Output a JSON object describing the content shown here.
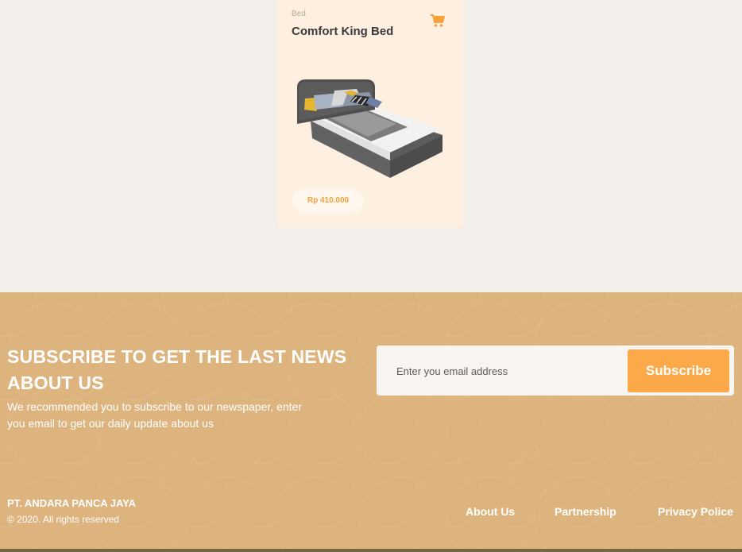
{
  "product": {
    "category": "Bed",
    "name": "Comfort King Bed",
    "price": "Rp 410.000",
    "cart_icon": "cart-icon",
    "image": "bed-image"
  },
  "subscribe": {
    "title_line1": "SUBSCRIBE TO GET THE LAST NEWS",
    "title_line2": "ABOUT US",
    "description_line1": "We recommended you to subscribe to our newspaper, enter",
    "description_line2": "you email to get our daily update about us",
    "email_placeholder": "Enter you email address",
    "button_label": "Subscribe"
  },
  "footer": {
    "company": "PT. ANDARA PANCA JAYA",
    "copyright": "© 2020. All rights reserved",
    "links": [
      "About Us",
      "Partnership",
      "Privacy Police"
    ]
  },
  "colors": {
    "accent": "#fba949",
    "footer_bg": "#ddb47e",
    "card_bg": "#fdf0e1",
    "page_bg": "#f2eee9"
  }
}
